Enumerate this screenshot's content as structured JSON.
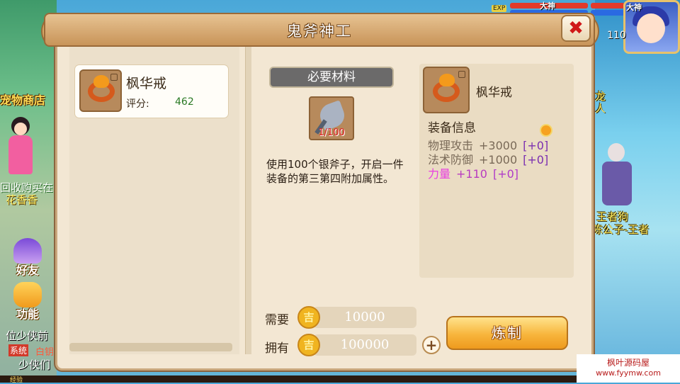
{
  "world": {
    "shop_label": "宠物商店",
    "npc_left_line1": "回收购买在",
    "npc_left_line2": "花香香",
    "friends_label": "好友",
    "function_label": "功能",
    "chat_line1": "位少侠前",
    "chat_tag_system": "系统",
    "chat_tag_red": "白钥",
    "chat_line2": "少侠们",
    "exp_label": "经验",
    "exp_badge": "EXP",
    "rank_label_1": "大神",
    "rank_label_2": "大神",
    "player_level": "110",
    "right_text_1": "龙",
    "right_text_2": "人",
    "npc_right_line1": "王者狗",
    "npc_right_line2": "陈公子-王者",
    "watermark_line1": "枫叶源码屋",
    "watermark_line2": "www.fyymw.com"
  },
  "dialog": {
    "title": "鬼斧神工",
    "close_icon": "x-icon"
  },
  "item_list": [
    {
      "name": "枫华戒",
      "score_label": "评分:",
      "score": "462",
      "icon": "ring-icon"
    }
  ],
  "materials": {
    "banner": "必要材料",
    "item_icon": "axe-icon",
    "count": "1/100",
    "description": "使用100个银斧子，开启一件装备的第三第四附加属性。"
  },
  "equip_info": {
    "name": "枫华戒",
    "header": "装备信息",
    "stats": [
      {
        "name": "物理攻击",
        "value": "+3000",
        "bonus": "[+0]"
      },
      {
        "name": "法术防御",
        "value": "+1000",
        "bonus": "[+0]"
      },
      {
        "name": "力量",
        "value": "+110",
        "bonus": "[+0]"
      }
    ]
  },
  "cost": {
    "need_label": "需要",
    "need_value": "10000",
    "have_label": "拥有",
    "have_value": "100000",
    "coin_glyph": "吉",
    "plus_label": "+"
  },
  "forge_button": "炼制",
  "colors": {
    "strength_stat": "#e83fe0",
    "bonus": "#7b2fb0",
    "score": "#2b7a25",
    "material_count": "#e02020"
  }
}
